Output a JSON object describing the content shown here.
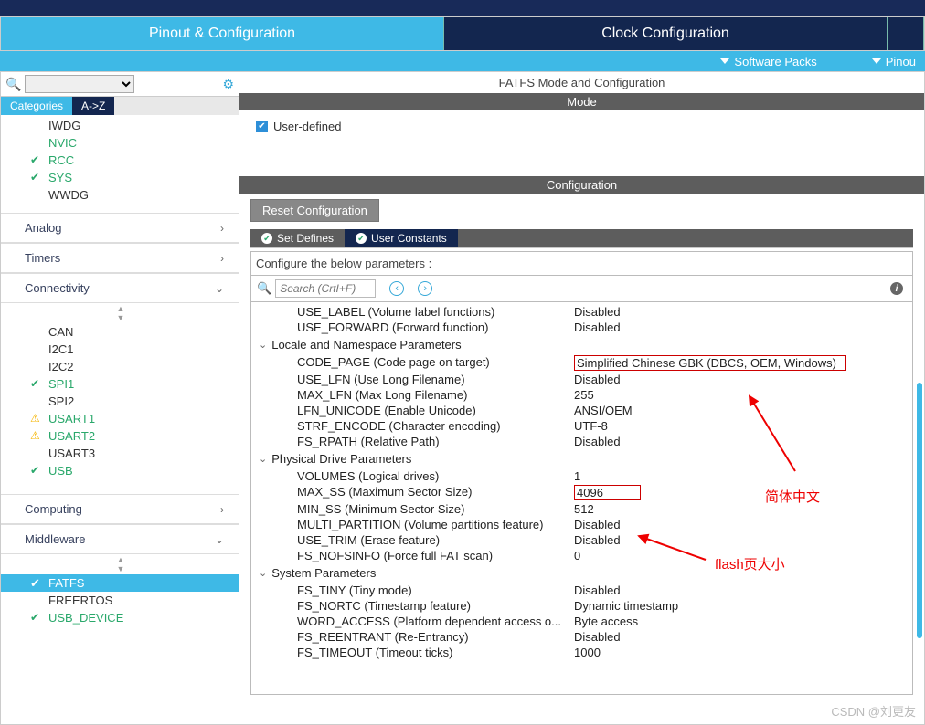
{
  "main_tabs": {
    "pinout": "Pinout & Configuration",
    "clock": "Clock Configuration"
  },
  "sub_tabs": {
    "software_packs": "Software Packs",
    "pinout": "Pinou"
  },
  "sidebar": {
    "view_cat": "Categories",
    "view_az": "A->Z",
    "core_items": [
      {
        "label": "IWDG",
        "kind": "black"
      },
      {
        "label": "NVIC",
        "kind": "green"
      },
      {
        "label": "RCC",
        "kind": "green",
        "icon": "check"
      },
      {
        "label": "SYS",
        "kind": "green",
        "icon": "check"
      },
      {
        "label": "WWDG",
        "kind": "black"
      }
    ],
    "cats": {
      "analog": "Analog",
      "timers": "Timers",
      "connectivity": "Connectivity",
      "computing": "Computing",
      "middleware": "Middleware"
    },
    "conn_items": [
      {
        "label": "CAN",
        "kind": "black"
      },
      {
        "label": "I2C1",
        "kind": "black"
      },
      {
        "label": "I2C2",
        "kind": "black"
      },
      {
        "label": "SPI1",
        "kind": "green",
        "icon": "check"
      },
      {
        "label": "SPI2",
        "kind": "black"
      },
      {
        "label": "USART1",
        "kind": "green",
        "icon": "warn"
      },
      {
        "label": "USART2",
        "kind": "green",
        "icon": "warn"
      },
      {
        "label": "USART3",
        "kind": "black"
      },
      {
        "label": "USB",
        "kind": "green",
        "icon": "check"
      }
    ],
    "mw_items": [
      {
        "label": "FATFS",
        "kind": "selected",
        "icon": "ocheck"
      },
      {
        "label": "FREERTOS",
        "kind": "black"
      },
      {
        "label": "USB_DEVICE",
        "kind": "green",
        "icon": "check"
      }
    ]
  },
  "main": {
    "title": "FATFS Mode and Configuration",
    "mode_header": "Mode",
    "user_defined": "User-defined",
    "config_header": "Configuration",
    "reset_btn": "Reset Configuration",
    "tabs": {
      "defines": "Set Defines",
      "constants": "User Constants"
    },
    "help": "Configure the below parameters :",
    "search_ph": "Search (CrtI+F)",
    "groups": {
      "locale": "Locale and Namespace Parameters",
      "physical": "Physical Drive Parameters",
      "system": "System Parameters"
    },
    "params": {
      "use_label": {
        "l": "USE_LABEL (Volume label functions)",
        "v": "Disabled"
      },
      "use_forward": {
        "l": "USE_FORWARD (Forward function)",
        "v": "Disabled"
      },
      "code_page": {
        "l": "CODE_PAGE (Code page on target)",
        "v": "Simplified Chinese GBK (DBCS, OEM, Windows)"
      },
      "use_lfn": {
        "l": "USE_LFN (Use Long Filename)",
        "v": "Disabled"
      },
      "max_lfn": {
        "l": "MAX_LFN (Max Long Filename)",
        "v": "255"
      },
      "lfn_unicode": {
        "l": "LFN_UNICODE (Enable Unicode)",
        "v": "ANSI/OEM"
      },
      "strf_encode": {
        "l": "STRF_ENCODE (Character encoding)",
        "v": "UTF-8"
      },
      "fs_rpath": {
        "l": "FS_RPATH (Relative Path)",
        "v": "Disabled"
      },
      "volumes": {
        "l": "VOLUMES (Logical drives)",
        "v": "1"
      },
      "max_ss": {
        "l": "MAX_SS (Maximum Sector Size)",
        "v": "4096"
      },
      "min_ss": {
        "l": "MIN_SS (Minimum Sector Size)",
        "v": "512"
      },
      "multi_partition": {
        "l": "MULTI_PARTITION (Volume partitions feature)",
        "v": "Disabled"
      },
      "use_trim": {
        "l": "USE_TRIM (Erase feature)",
        "v": "Disabled"
      },
      "fs_nofsinfo": {
        "l": "FS_NOFSINFO (Force full FAT scan)",
        "v": "0"
      },
      "fs_tiny": {
        "l": "FS_TINY (Tiny mode)",
        "v": "Disabled"
      },
      "fs_nortc": {
        "l": "FS_NORTC (Timestamp feature)",
        "v": "Dynamic timestamp"
      },
      "word_access": {
        "l": "WORD_ACCESS (Platform dependent access o...",
        "v": "Byte access"
      },
      "fs_reentrant": {
        "l": "FS_REENTRANT (Re-Entrancy)",
        "v": "Disabled"
      },
      "fs_timeout": {
        "l": "FS_TIMEOUT (Timeout ticks)",
        "v": "1000"
      }
    }
  },
  "annotations": {
    "chinese": "简体中文",
    "flash": "flash页大小"
  },
  "watermark": "CSDN @刘更友"
}
